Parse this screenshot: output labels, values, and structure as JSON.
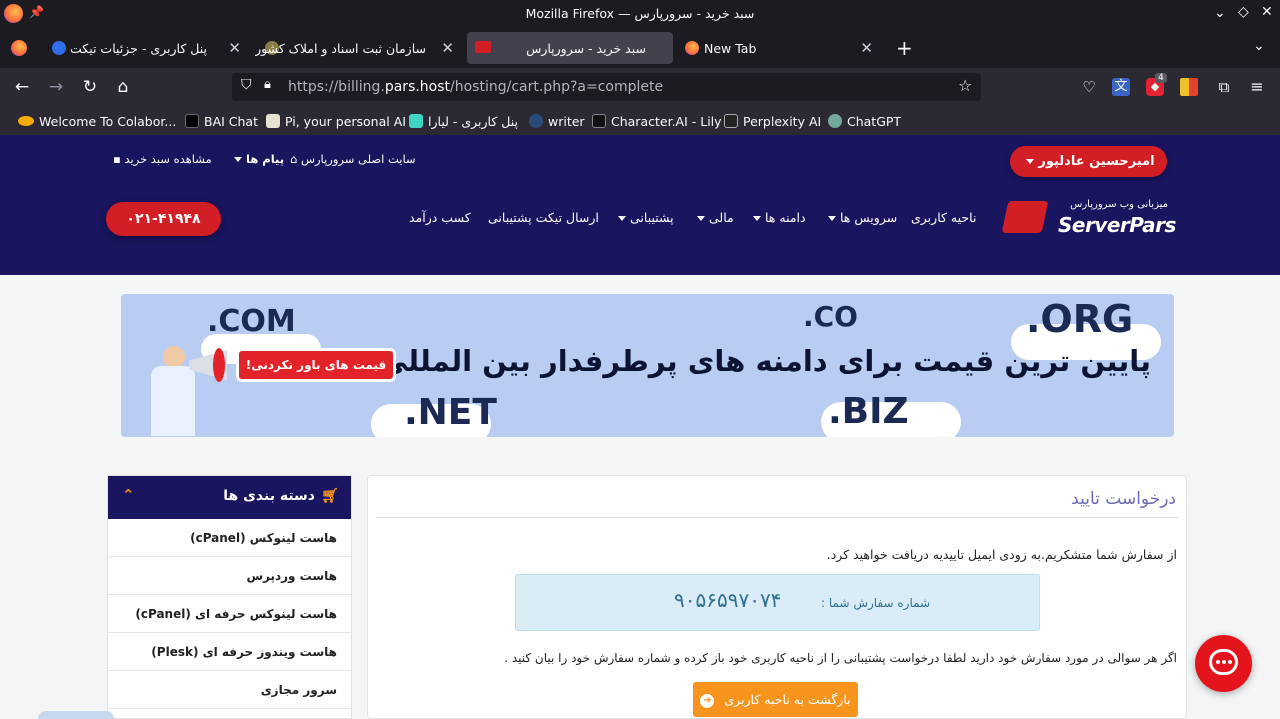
{
  "window": {
    "title": "Mozilla Firefox — سبد خرید - سرورپارس"
  },
  "tabs": [
    {
      "title": "پنل کاربری - جزئیات تیکت",
      "active": false
    },
    {
      "title": "سازمان ثبت اسناد و املاک کشور",
      "active": false
    },
    {
      "title": "سبد خرید - سرورپارس",
      "active": true
    },
    {
      "title": "New Tab",
      "active": false
    }
  ],
  "urlbar": {
    "prefix": "https://billing.",
    "domain": "pars.host",
    "path": "/hosting/cart.php?a=complete"
  },
  "toolbar": {
    "extension_badge": "4"
  },
  "bookmarks": [
    {
      "label": "Welcome To Colabor...",
      "icon": "colab-icon"
    },
    {
      "label": "BAI Chat",
      "icon": "bai-icon"
    },
    {
      "label": "Pi, your personal AI",
      "icon": "pi-icon"
    },
    {
      "label": "پنل کاربری - لیارا",
      "icon": "liara-icon"
    },
    {
      "label": "writer",
      "icon": "writer-icon"
    },
    {
      "label": "Character.AI - Lily",
      "icon": "characterai-icon"
    },
    {
      "label": "Perplexity AI",
      "icon": "perplexity-icon"
    },
    {
      "label": "ChatGPT",
      "icon": "chatgpt-icon"
    }
  ],
  "header": {
    "top_links": {
      "main_site": "سایت اصلی سرورپارس",
      "messages": "پیام ها",
      "view_cart": "مشاهده سبد خرید"
    },
    "user_button": "امیرحسین عادلپور",
    "phone": "۰۲۱-۴۱۹۴۸",
    "logo_text": "ServerPars",
    "logo_tagline": "میزبانی وب سرورپارس",
    "menu": [
      {
        "label": "ناحیه کاربری",
        "dropdown": false
      },
      {
        "label": "سرویس ها",
        "dropdown": true
      },
      {
        "label": "دامنه ها",
        "dropdown": true
      },
      {
        "label": "مالی",
        "dropdown": true
      },
      {
        "label": "پشتیبانی",
        "dropdown": true
      },
      {
        "label": "ارسال تیکت پشتیبانی",
        "dropdown": false
      },
      {
        "label": "کسب درآمد",
        "dropdown": false
      }
    ]
  },
  "banner": {
    "headline": "پایین ترین قیمت برای دامنه های پرطرفدار بین المللی",
    "badge": "قیمت های باور نکردنی!",
    "tlds": [
      ".COM",
      ".CO",
      ".ORG",
      ".NET",
      ".BIZ"
    ]
  },
  "sidebar": {
    "title": "دسته بندی ها",
    "items": [
      "هاست لینوکس (cPanel)",
      "هاست وردپرس",
      "هاست لینوکس حرفه ای (cPanel)",
      "هاست ویندوز حرفه ای (Plesk)",
      "سرور مجازی"
    ]
  },
  "main": {
    "title": "درخواست تایید",
    "thanks": "از سفارش شما متشکریم.به زودی ایمیل تاییدیه دریافت خواهید کرد.",
    "order_label": "شماره سفارش شما :",
    "order_number": "۹۰۵۶۵۹۷۰۷۴",
    "help_text": "اگر هر سوالی در مورد سفارش خود دارید لطفا درخواست پشتیبانی را از ناحیه کاربری خود باز کرده و شماره سفارش خود را بیان کنید .",
    "back_button": "بازگشت به ناحیه کاربری"
  },
  "colors": {
    "header_bg": "#19155e",
    "accent_red": "#d21f26",
    "button_orange": "#f7941d",
    "order_box_bg": "#d9ecf7"
  }
}
